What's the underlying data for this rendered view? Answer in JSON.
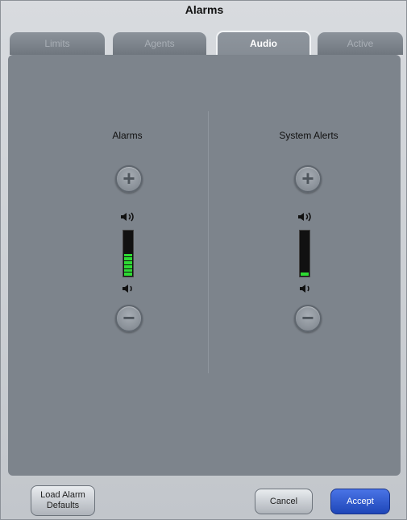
{
  "window": {
    "title": "Alarms"
  },
  "tabs": [
    {
      "label": "Limits",
      "active": false
    },
    {
      "label": "Agents",
      "active": false
    },
    {
      "label": "Audio",
      "active": true
    },
    {
      "label": "Active",
      "active": false
    }
  ],
  "audio": {
    "alarms": {
      "label": "Alarms",
      "level_segments": 6,
      "max_segments": 12,
      "increase_symbol": "+",
      "decrease_symbol": "−"
    },
    "system_alerts": {
      "label": "System Alerts",
      "level_segments": 1,
      "max_segments": 12,
      "increase_symbol": "+",
      "decrease_symbol": "−"
    }
  },
  "footer": {
    "load_defaults_label_line1": "Load Alarm",
    "load_defaults_label_line2": "Defaults",
    "cancel_label": "Cancel",
    "accept_label": "Accept"
  },
  "colors": {
    "meter_fill": "#2ddb33",
    "accent": "#2b55cf",
    "panel": "#7d848c"
  },
  "icons": [
    "plus-icon",
    "minus-icon",
    "volume-high-icon",
    "volume-low-icon"
  ]
}
